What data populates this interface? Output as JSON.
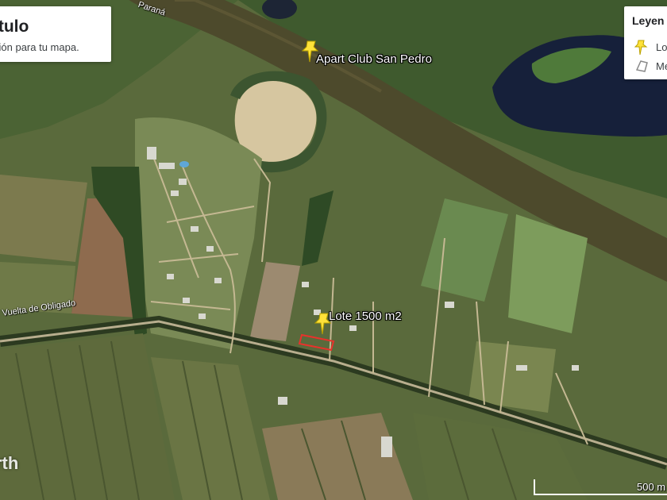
{
  "map": {
    "type": "satellite",
    "watermark": "rth",
    "scale_label": "500 m",
    "colors": {
      "river": "#4d4a2c",
      "lagoon": "#16203a",
      "placemark": "#ffe23a",
      "plot_outline": "#e8322b"
    }
  },
  "title_card": {
    "title": "ítulo",
    "description": "ción para tu mapa."
  },
  "legend": {
    "heading": "Leyen",
    "items": [
      {
        "icon": "pushpin-icon",
        "label": "Lo"
      },
      {
        "icon": "polygon-icon",
        "label": "Me"
      }
    ]
  },
  "placemarks": [
    {
      "name": "Apart Club San Pedro",
      "icon": "pushpin-icon"
    },
    {
      "name": "Lote 1500 m2",
      "icon": "pushpin-icon"
    }
  ],
  "road_labels": [
    {
      "text": "Vuelta de Obligado"
    },
    {
      "text": "Paraná"
    }
  ]
}
